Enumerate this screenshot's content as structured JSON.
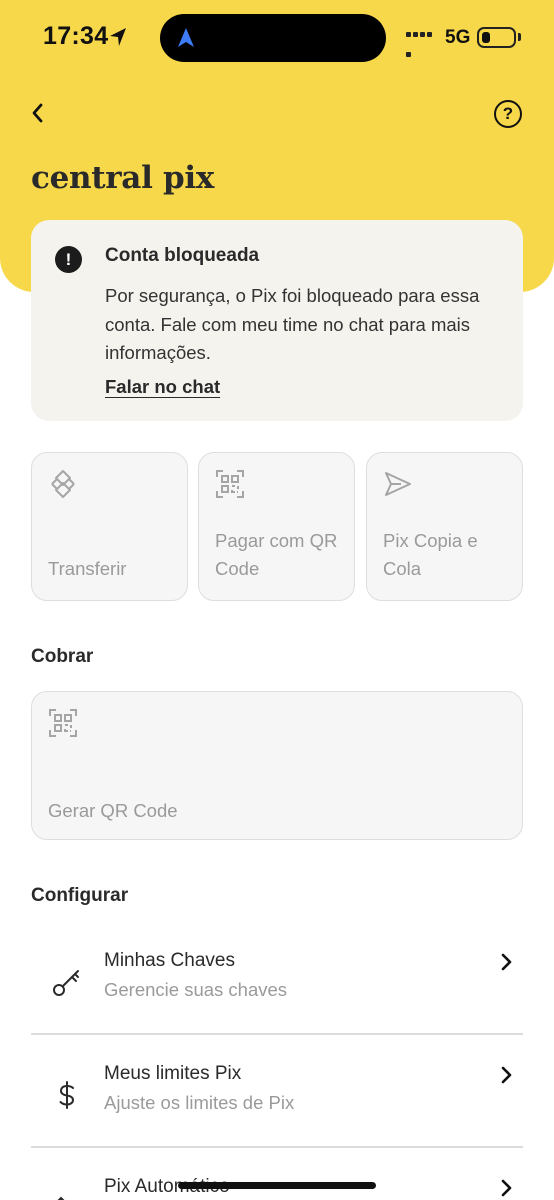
{
  "status_bar": {
    "time": "17:34",
    "network": "5G",
    "battery_level": 0.25
  },
  "header": {
    "title": "central pix",
    "back_icon": "chevron-left-icon",
    "help_icon": "question-circle-icon",
    "help_symbol": "?"
  },
  "alert": {
    "icon_symbol": "!",
    "title": "Conta bloqueada",
    "body": "Por segurança, o Pix foi bloqueado para essa conta. Fale com meu time no chat para mais informações.",
    "link": "Falar no chat"
  },
  "actions": [
    {
      "label": "Transferir",
      "icon": "pix-diamond-icon"
    },
    {
      "label": "Pagar com QR Code",
      "icon": "qr-code-icon"
    },
    {
      "label": "Pix Copia e Cola",
      "icon": "send-arrow-icon"
    }
  ],
  "cobrar": {
    "section_title": "Cobrar",
    "tile_label": "Gerar QR Code",
    "tile_icon": "qr-code-icon"
  },
  "configurar": {
    "section_title": "Configurar",
    "items": [
      {
        "title": "Minhas Chaves",
        "subtitle": "Gerencie suas chaves",
        "icon": "key-icon"
      },
      {
        "title": "Meus limites Pix",
        "subtitle": "Ajuste os limites de Pix",
        "icon": "dollar-icon"
      },
      {
        "title": "Pix Automático",
        "subtitle": "",
        "icon": "auto-transfer-icon"
      }
    ]
  },
  "colors": {
    "header_yellow": "#f7d84a",
    "card_beige": "#f5f3ee",
    "tile_gray": "#f6f6f6",
    "muted_text": "#9a9a9a"
  }
}
